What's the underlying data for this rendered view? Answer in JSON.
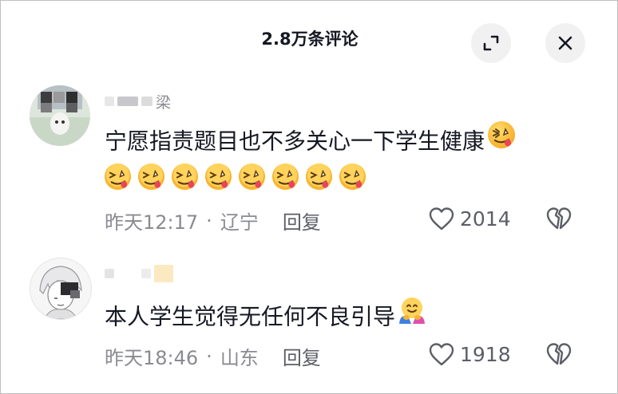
{
  "header": {
    "title": "2.8万条评论",
    "expand_icon": "expand-icon",
    "close_icon": "close-icon"
  },
  "comments": [
    {
      "username_visible": "梁",
      "text": "宁愿指责题目也不多关心一下学生健康",
      "emoji": "drooling-face-icon",
      "emoji_row_count": 8,
      "time": "昨天12:17",
      "separator": "·",
      "location": "辽宁",
      "reply_label": "回复",
      "likes": "2014",
      "like_icon": "heart-icon",
      "dislike_icon": "broken-heart-icon"
    },
    {
      "username_visible": "",
      "text": "本人学生觉得无任何不良引导",
      "emoji": "hugging-face-icon",
      "time": "昨天18:46",
      "separator": "·",
      "location": "山东",
      "reply_label": "回复",
      "likes": "1918",
      "like_icon": "heart-icon",
      "dislike_icon": "broken-heart-icon"
    }
  ],
  "colors": {
    "primary_text": "#161823",
    "secondary_text": "#8a8b91",
    "button_bg": "#f1f1f2"
  }
}
